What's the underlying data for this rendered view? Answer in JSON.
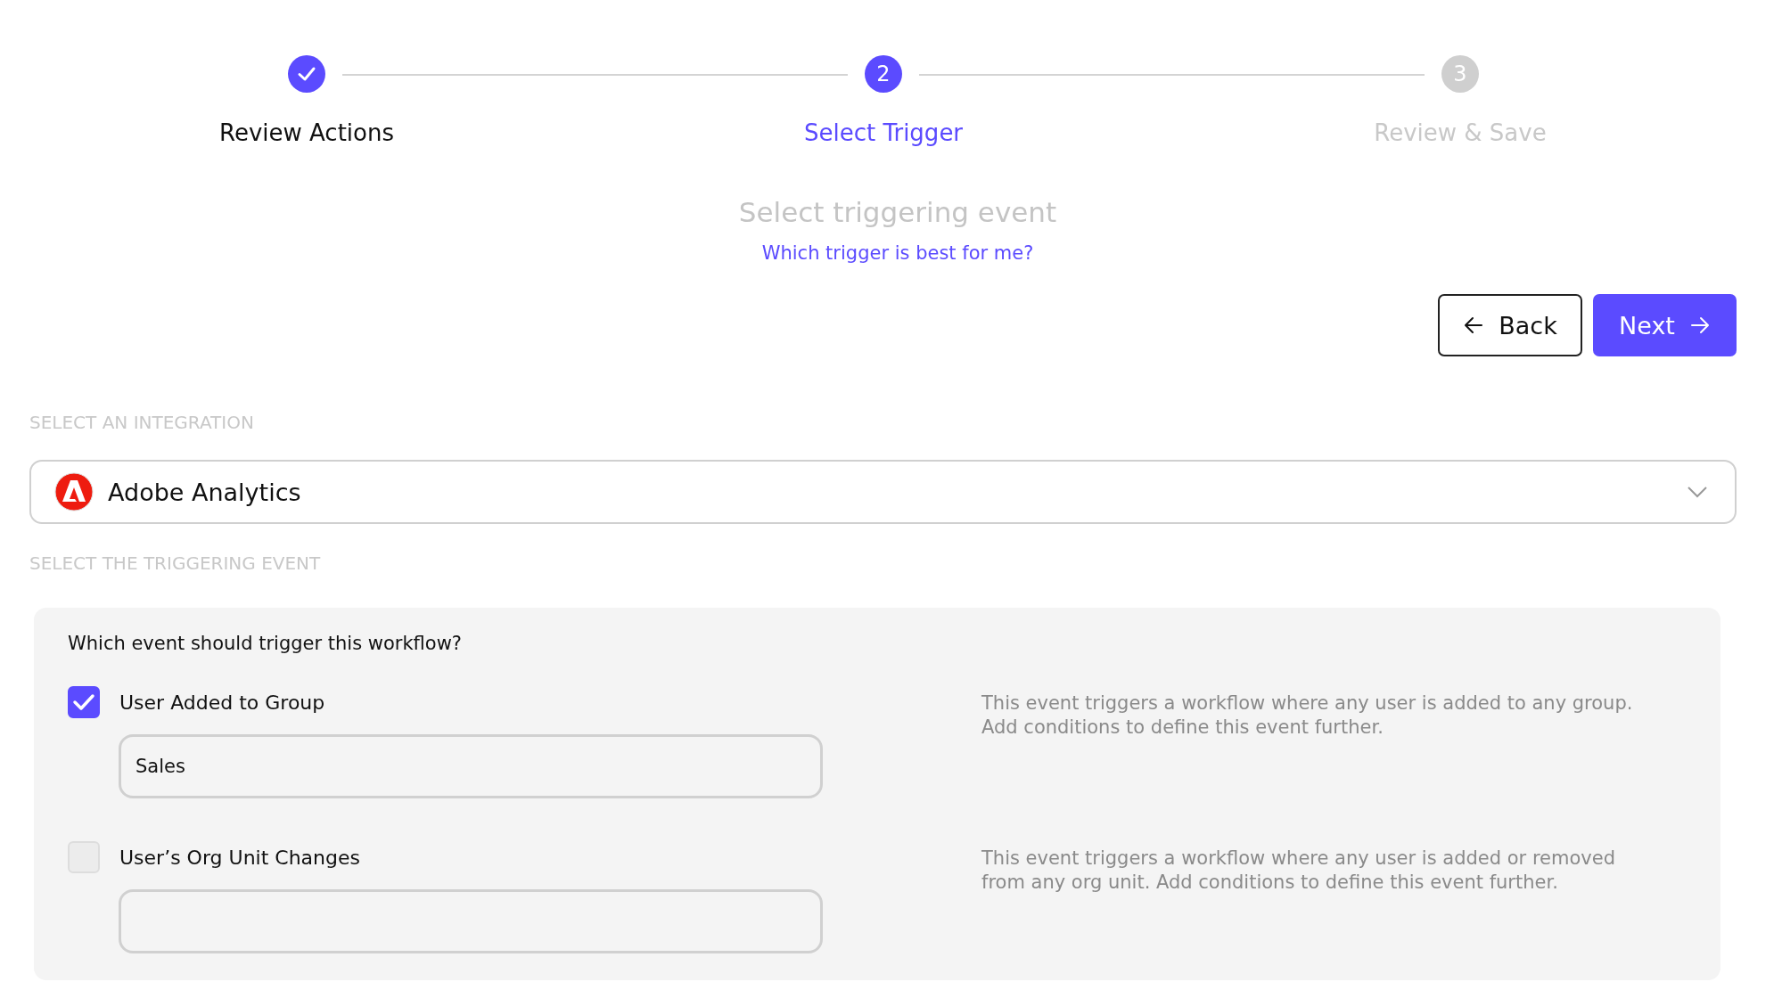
{
  "steps": [
    {
      "label": "Review Actions",
      "completed": true,
      "selected": false
    },
    {
      "label": "Select Trigger",
      "number": "2",
      "completed": false,
      "selected": true
    },
    {
      "label": "Review & Save",
      "number": "3",
      "completed": false,
      "selected": false
    }
  ],
  "heading": {
    "title": "Select triggering event",
    "help_link": "Which trigger is best for me?"
  },
  "buttons": {
    "back": "Back",
    "next": "Next"
  },
  "integration": {
    "section_label": "SELECT AN INTEGRATION",
    "value": "Adobe Analytics"
  },
  "events": {
    "section_label": "SELECT  THE TRIGGERING EVENT",
    "question": "Which event should trigger this workflow?",
    "items": [
      {
        "label": "User Added to Group",
        "checked": true,
        "value": "Sales",
        "description": "This event triggers a workflow where any user is added to any group.\nAdd conditions to define this event further."
      },
      {
        "label": "User’s  Org Unit Changes",
        "checked": false,
        "description": "This event triggers a workflow where any user is added or removed\nfrom any org unit.  Add conditions to define this event further."
      }
    ]
  }
}
